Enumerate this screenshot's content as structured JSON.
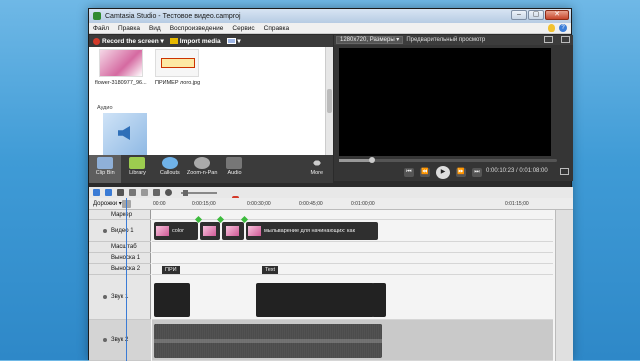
{
  "window": {
    "title": "Camtasia Studio - Тестовое видео.camproj"
  },
  "menu": [
    "Файл",
    "Правка",
    "Вид",
    "Воспроизведение",
    "Сервис",
    "Справка"
  ],
  "clip_toolbar": {
    "record": "Record the screen",
    "import": "Import media"
  },
  "clip_bin": {
    "items": [
      {
        "label": "flower-3180977_96..."
      },
      {
        "label": "ПРИМЕР лого.jpg",
        "logo_text": "У Хельги"
      }
    ],
    "audio_section": "Аудио"
  },
  "preview": {
    "size": "1280x720, Размеры",
    "mode": "Предварительный просмотр",
    "timecode": "0:00:10:23 / 0:01:08:00"
  },
  "tasks": [
    "Clip Bin",
    "Library",
    "Callouts",
    "Zoom-n-Pan",
    "Audio",
    "More"
  ],
  "timeline": {
    "tracks_label": "Дорожки",
    "ruler": [
      "00:00",
      "0:00:15;00",
      "0:00:30;00",
      "0:00:45;00",
      "0:01:00;00",
      "0:01:15;00"
    ],
    "track_names": [
      "Маркер",
      "Видео 1",
      "Масштаб",
      "Выноска 1",
      "Выноска 2",
      "Звук 1",
      "Звук 2"
    ],
    "video_clips": [
      {
        "label": "color"
      },
      {
        "label": ""
      },
      {
        "label": ""
      },
      {
        "label": "мыльварение для начинающих: как"
      }
    ],
    "callouts": [
      {
        "label": "ПРИ"
      },
      {
        "label": "Text"
      }
    ]
  },
  "colors": {
    "accent": "#3a7bd5",
    "record": "#d43a2a"
  }
}
